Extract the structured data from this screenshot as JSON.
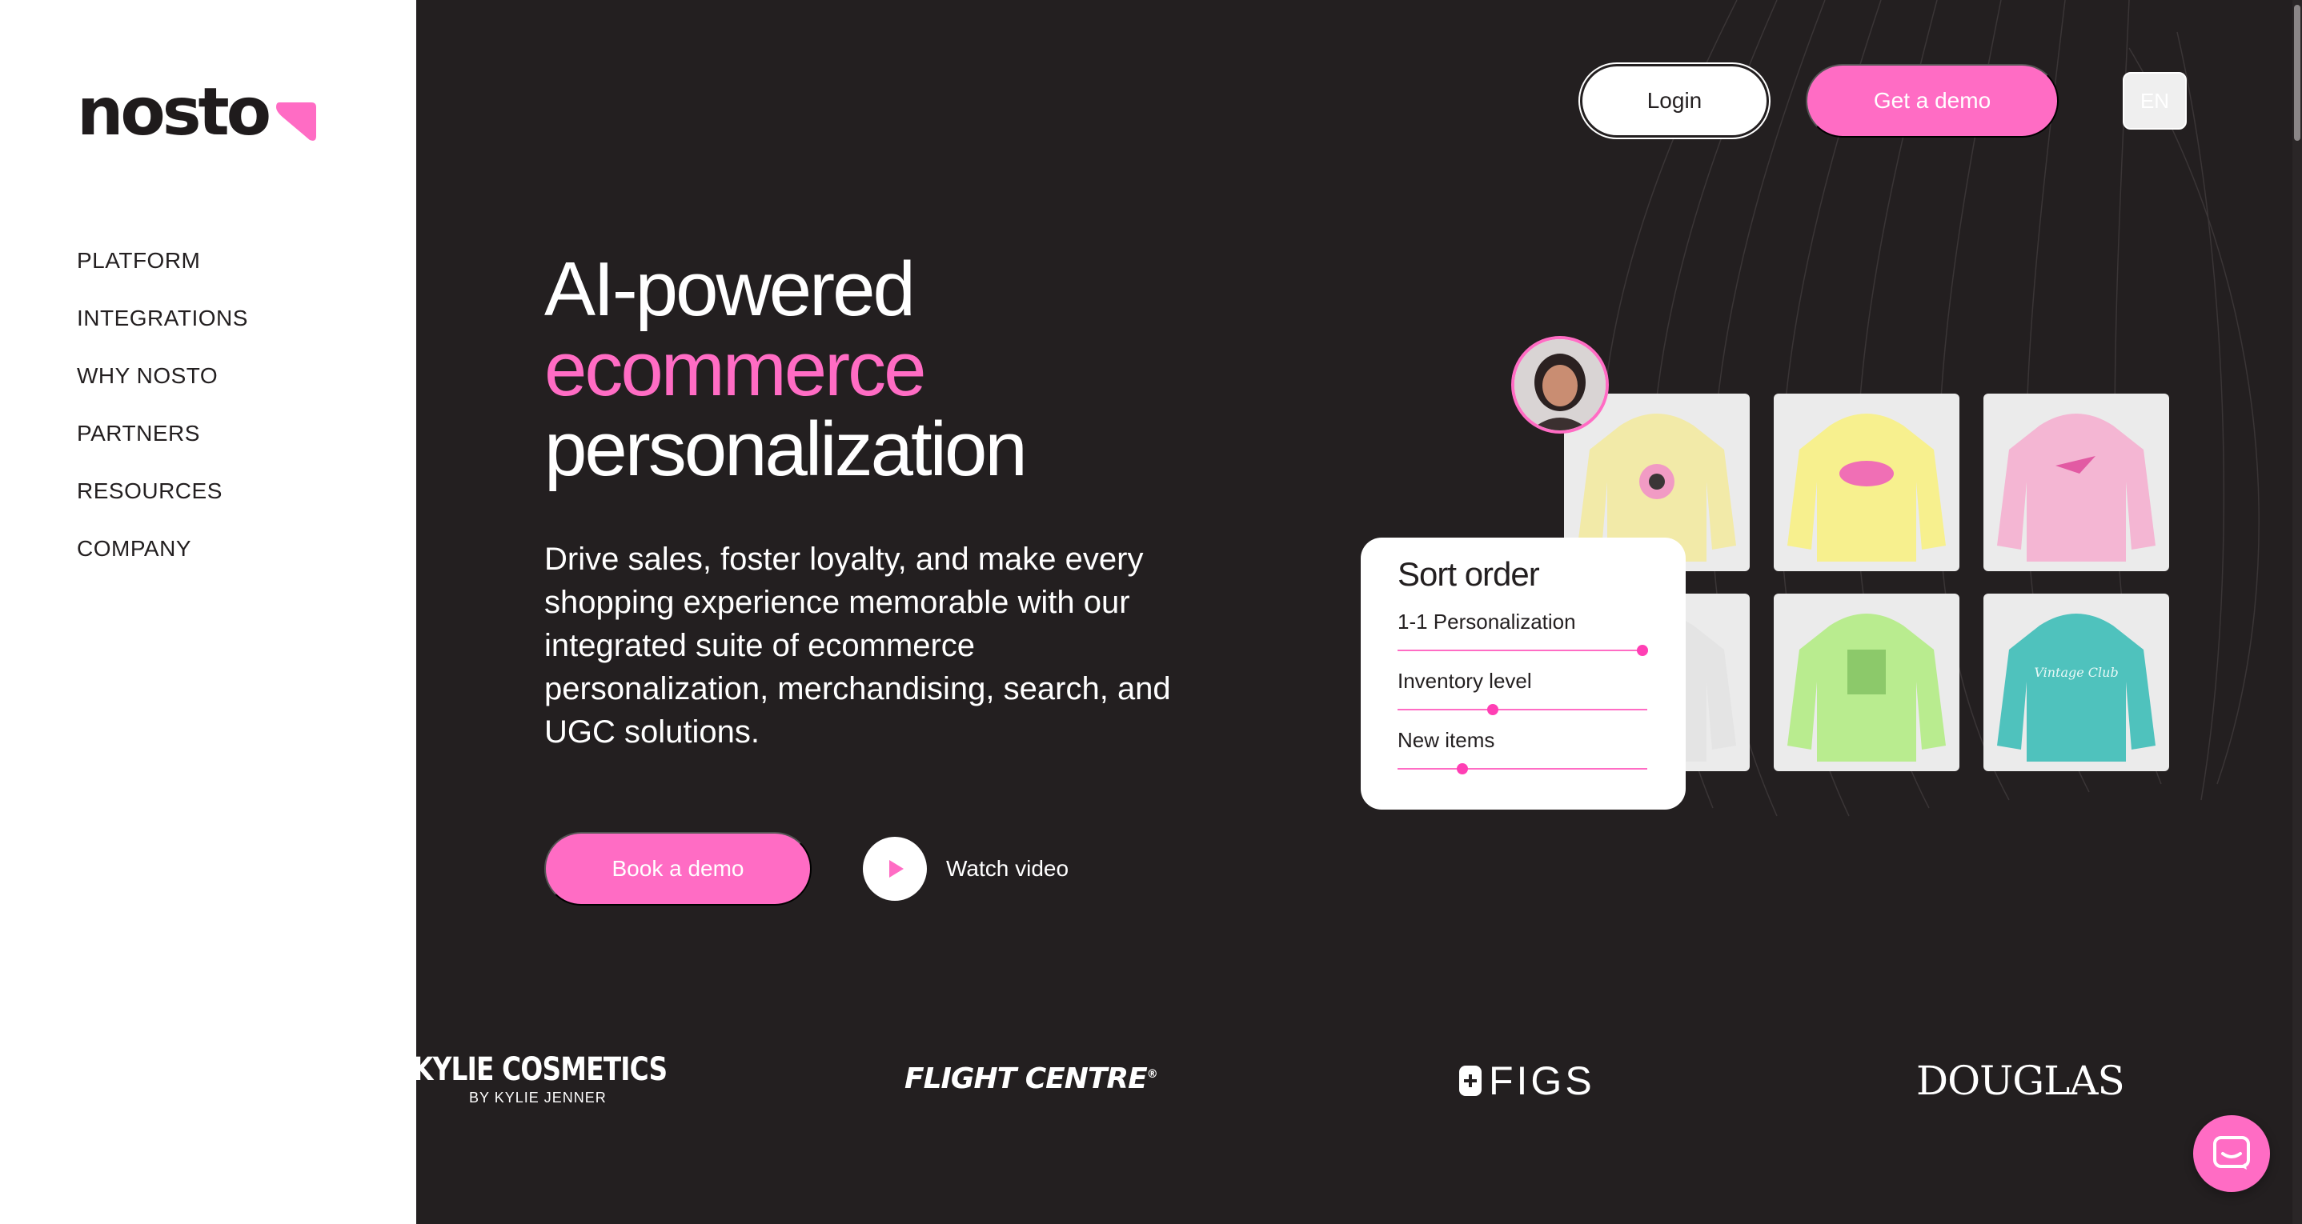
{
  "brand": {
    "name": "nosto",
    "accent": "#ff6cc4",
    "dark": "#231f20"
  },
  "nav": {
    "items": [
      "PLATFORM",
      "INTEGRATIONS",
      "WHY NOSTO",
      "PARTNERS",
      "RESOURCES",
      "COMPANY"
    ]
  },
  "header": {
    "login": "Login",
    "demo": "Get a demo",
    "lang": "EN"
  },
  "hero": {
    "line1": "AI-powered",
    "line2": "ecommerce",
    "line3": "personalization",
    "description": "Drive sales, foster loyalty, and make every shopping experience memorable with our integrated suite of ecommerce personalization, merchandising, search, and UGC solutions.",
    "book_demo": "Book a demo",
    "watch_video": "Watch video"
  },
  "sort_card": {
    "title": "Sort order",
    "sliders": [
      {
        "label": "1-1 Personalization",
        "value": 0.98
      },
      {
        "label": "Inventory level",
        "value": 0.38
      },
      {
        "label": "New items",
        "value": 0.26
      }
    ]
  },
  "products": {
    "tiles": [
      {
        "color": "#f2eaa8",
        "text": ""
      },
      {
        "color": "#f7f08e",
        "text": ""
      },
      {
        "color": "#f4b6d3",
        "text": ""
      },
      {
        "color": "#e9e9e9",
        "text": ""
      },
      {
        "color": "#b9ec8f",
        "text": ""
      },
      {
        "color": "#4fc2bd",
        "text": "Vintage Club"
      }
    ]
  },
  "brands": {
    "kylie_main": "KYLIE COSMETICS",
    "kylie_sub": "BY KYLIE JENNER",
    "flight": "FLIGHT CENTRE",
    "flight_reg": "®",
    "figs": "FIGS",
    "douglas": "DOUGLAS"
  }
}
